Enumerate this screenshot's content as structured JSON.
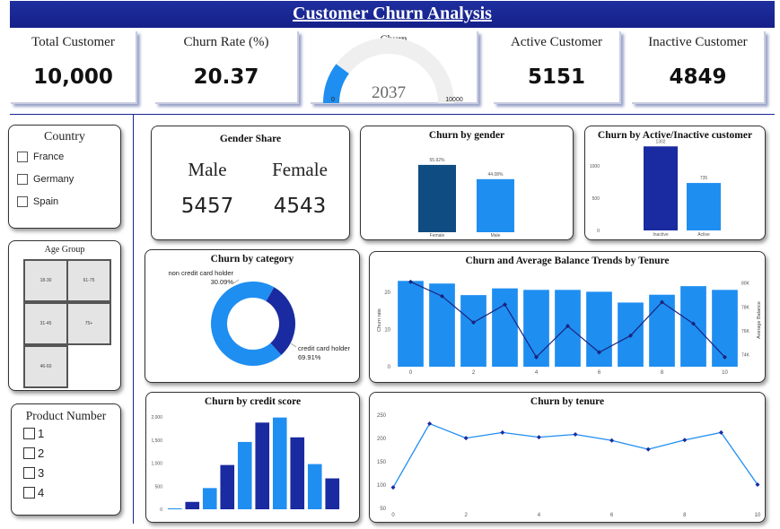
{
  "header": {
    "title": "Customer Churn Analysis"
  },
  "kpis": {
    "total_customer": {
      "label": "Total Customer",
      "value": "10,000"
    },
    "churn_rate": {
      "label": "Churn Rate (%)",
      "value": "20.37"
    },
    "active_customer": {
      "label": "Active Customer",
      "value": "5151"
    },
    "inactive_customer": {
      "label": "Inactive Customer",
      "value": "4849"
    }
  },
  "gauge": {
    "label": "Churn",
    "value": 2037,
    "value_text": "2037",
    "min": 0,
    "min_text": "0",
    "max": 10000,
    "max_text": "10000",
    "fill_color": "#1f8ef1",
    "track_color": "#efefef"
  },
  "filters": {
    "country": {
      "title": "Country",
      "options": [
        "France",
        "Germany",
        "Spain"
      ]
    },
    "age_group": {
      "title": "Age Group",
      "tiles": [
        "18-30",
        "61-75",
        "31-45",
        "75+",
        "46-60"
      ]
    },
    "product_number": {
      "title": "Product Number",
      "options": [
        "1",
        "2",
        "3",
        "4"
      ]
    }
  },
  "gender_share": {
    "title": "Gender Share",
    "male_label": "Male",
    "female_label": "Female",
    "male_value": "5457",
    "female_value": "4543"
  },
  "colors": {
    "dark_navy": "#0f4c81",
    "navy": "#1a2aa0",
    "bright_blue": "#1f8ef1",
    "header_blue": "#1a2796",
    "line_navy": "#1a237e"
  },
  "chart_data": [
    {
      "id": "churn_by_gender",
      "type": "bar",
      "title": "Churn by gender",
      "categories": [
        "Female",
        "Male"
      ],
      "values": [
        55.92,
        44.08
      ],
      "data_labels": [
        "55.92%",
        "44.08%"
      ],
      "ylim": [
        0,
        70
      ],
      "colors": [
        "#0f4c81",
        "#1f8ef1"
      ]
    },
    {
      "id": "churn_by_active",
      "type": "bar",
      "title": "Churn by Active/Inactive customer",
      "categories": [
        "Inactive",
        "Active"
      ],
      "values": [
        1302,
        735
      ],
      "data_labels": [
        "1302",
        "735"
      ],
      "yticks": [
        0,
        500,
        1000
      ],
      "ylim": [
        0,
        1500
      ],
      "colors": [
        "#1a2aa0",
        "#1f8ef1"
      ]
    },
    {
      "id": "churn_by_category",
      "type": "pie",
      "title": "Churn by category",
      "slices": [
        {
          "label": "non credit card holder",
          "value_text": "30.09%",
          "value": 30.09,
          "color": "#1a2aa0"
        },
        {
          "label": "credit card holder",
          "value_text": "69.91%",
          "value": 69.91,
          "color": "#1f8ef1"
        }
      ]
    },
    {
      "id": "churn_balance_tenure",
      "type": "bar",
      "title": "Churn and Average Balance Trends by Tenure",
      "x": [
        0,
        1,
        2,
        3,
        4,
        5,
        6,
        7,
        8,
        9,
        10
      ],
      "xticks": [
        0,
        2,
        4,
        6,
        8,
        10
      ],
      "series": [
        {
          "kind": "bar",
          "axis": "left",
          "values": [
            23,
            22.3,
            19.2,
            21,
            20.6,
            20.6,
            20.1,
            17.2,
            19.3,
            21.6,
            20.6
          ],
          "color": "#1f8ef1"
        },
        {
          "kind": "line",
          "axis": "right",
          "values": [
            80.1,
            78.9,
            76.7,
            78.2,
            73.8,
            76.4,
            74.2,
            75.6,
            78.4,
            76.6,
            73.8
          ],
          "color": "#1a237e"
        }
      ],
      "ylabel": "Churn rate",
      "ylabel_right": "Average Balance",
      "yticks": [
        0,
        10,
        20
      ],
      "ylim": [
        0,
        25
      ],
      "yticks_right": [
        74,
        76,
        78,
        80
      ],
      "ytick_right_labels": [
        "74K",
        "76K",
        "78K",
        "80K"
      ],
      "ylim_right": [
        73,
        80.8
      ]
    },
    {
      "id": "churn_by_credit_score",
      "type": "bar",
      "title": "Churn by credit score",
      "values": [
        20,
        160,
        460,
        960,
        1460,
        1880,
        1990,
        1560,
        980,
        670
      ],
      "colors": [
        "#1f8ef1",
        "#1a2aa0",
        "#1f8ef1",
        "#1a2aa0",
        "#1f8ef1",
        "#1a2aa0",
        "#1f8ef1",
        "#1a2aa0",
        "#1f8ef1",
        "#1a2aa0"
      ],
      "yticks": [
        0,
        500,
        1000,
        1500,
        2000
      ],
      "ytick_labels": [
        "0",
        "500",
        "1,000",
        "1,500",
        "2,000"
      ],
      "ylim": [
        0,
        2100
      ]
    },
    {
      "id": "churn_by_tenure",
      "type": "line",
      "title": "Churn by tenure",
      "x": [
        0,
        1,
        2,
        3,
        4,
        5,
        6,
        7,
        8,
        9,
        10
      ],
      "values": [
        95,
        232,
        201,
        213,
        203,
        209,
        196,
        177,
        197,
        213,
        101
      ],
      "xticks": [
        0,
        2,
        4,
        6,
        8,
        10
      ],
      "yticks": [
        50,
        100,
        150,
        200,
        250
      ],
      "ylim": [
        50,
        260
      ],
      "color": "#1f8ef1",
      "marker_color": "#1a2aa0"
    }
  ]
}
